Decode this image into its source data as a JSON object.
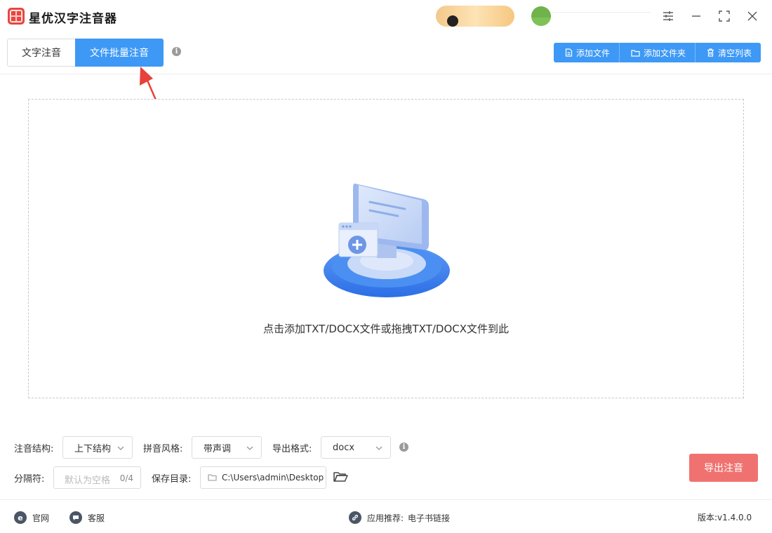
{
  "app": {
    "title": "星优汉字注音器"
  },
  "tabs": [
    {
      "label": "文字注音"
    },
    {
      "label": "文件批量注音"
    }
  ],
  "toolbar": {
    "add_file": "添加文件",
    "add_folder": "添加文件夹",
    "clear_list": "清空列表"
  },
  "dropzone": {
    "hint": "点击添加TXT/DOCX文件或拖拽TXT/DOCX文件到此"
  },
  "settings": {
    "structure_label": "注音结构:",
    "structure_value": "上下结构",
    "style_label": "拼音风格:",
    "style_value": "带声调",
    "format_label": "导出格式:",
    "format_value": "docx",
    "separator_label": "分隔符:",
    "separator_placeholder": "默认为空格",
    "separator_count": "0/4",
    "savedir_label": "保存目录:",
    "savedir_value": "C:\\Users\\admin\\Desktop"
  },
  "actions": {
    "export": "导出注音"
  },
  "footer": {
    "website": "官网",
    "support": "客服",
    "recommend_label": "应用推荐:",
    "recommend_value": "电子书链接",
    "version": "版本:v1.4.0.0"
  },
  "colors": {
    "primary": "#3d99f5",
    "export": "#f07270",
    "logo": "#e9463f"
  }
}
